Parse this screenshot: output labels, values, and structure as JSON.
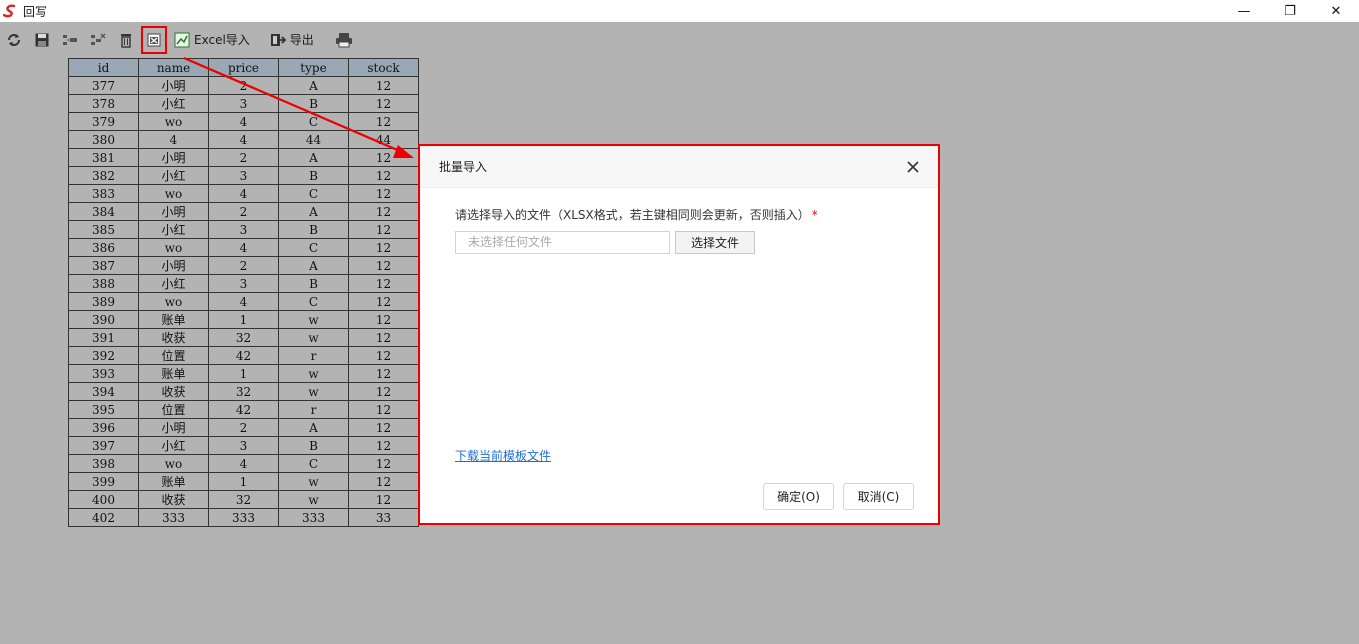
{
  "window": {
    "title": "回写",
    "controls": {
      "minimize": "—",
      "restore": "❐",
      "close": "✕"
    }
  },
  "toolbar": {
    "items": [
      {
        "name": "refresh",
        "icon": "refresh-icon"
      },
      {
        "name": "save",
        "icon": "save-icon"
      },
      {
        "name": "insert-row",
        "icon": "insert-row-icon"
      },
      {
        "name": "delete-row",
        "icon": "delete-row-icon"
      },
      {
        "name": "delete",
        "icon": "trash-icon"
      },
      {
        "name": "batch-import",
        "icon": "excel-import-icon"
      }
    ],
    "excel_import_label": "Excel导入",
    "export_label": "导出",
    "print_icon": "printer-icon"
  },
  "table": {
    "headers": [
      "id",
      "name",
      "price",
      "type",
      "stock"
    ],
    "rows": [
      [
        "377",
        "小明",
        "2",
        "A",
        "12"
      ],
      [
        "378",
        "小红",
        "3",
        "B",
        "12"
      ],
      [
        "379",
        "wo",
        "4",
        "C",
        "12"
      ],
      [
        "380",
        "4",
        "4",
        "44",
        "44"
      ],
      [
        "381",
        "小明",
        "2",
        "A",
        "12"
      ],
      [
        "382",
        "小红",
        "3",
        "B",
        "12"
      ],
      [
        "383",
        "wo",
        "4",
        "C",
        "12"
      ],
      [
        "384",
        "小明",
        "2",
        "A",
        "12"
      ],
      [
        "385",
        "小红",
        "3",
        "B",
        "12"
      ],
      [
        "386",
        "wo",
        "4",
        "C",
        "12"
      ],
      [
        "387",
        "小明",
        "2",
        "A",
        "12"
      ],
      [
        "388",
        "小红",
        "3",
        "B",
        "12"
      ],
      [
        "389",
        "wo",
        "4",
        "C",
        "12"
      ],
      [
        "390",
        "账单",
        "1",
        "w",
        "12"
      ],
      [
        "391",
        "收获",
        "32",
        "w",
        "12"
      ],
      [
        "392",
        "位置",
        "42",
        "r",
        "12"
      ],
      [
        "393",
        "账单",
        "1",
        "w",
        "12"
      ],
      [
        "394",
        "收获",
        "32",
        "w",
        "12"
      ],
      [
        "395",
        "位置",
        "42",
        "r",
        "12"
      ],
      [
        "396",
        "小明",
        "2",
        "A",
        "12"
      ],
      [
        "397",
        "小红",
        "3",
        "B",
        "12"
      ],
      [
        "398",
        "wo",
        "4",
        "C",
        "12"
      ],
      [
        "399",
        "账单",
        "1",
        "w",
        "12"
      ],
      [
        "400",
        "收获",
        "32",
        "w",
        "12"
      ],
      [
        "402",
        "333",
        "333",
        "333",
        "33"
      ]
    ]
  },
  "dialog": {
    "title": "批量导入",
    "close_glyph": "✕",
    "label": "请选择导入的文件（XLSX格式，若主键相同则会更新，否则插入）",
    "required_mark": "*",
    "file_placeholder": "未选择任何文件",
    "choose_file_label": "选择文件",
    "download_template_label": "下载当前模板文件",
    "ok_label": "确定(O)",
    "cancel_label": "取消(C)"
  },
  "colors": {
    "highlight": "#ee0000",
    "link": "#1e6fd0",
    "background": "#b3b3b3",
    "table_header": "#9aa7b4"
  }
}
